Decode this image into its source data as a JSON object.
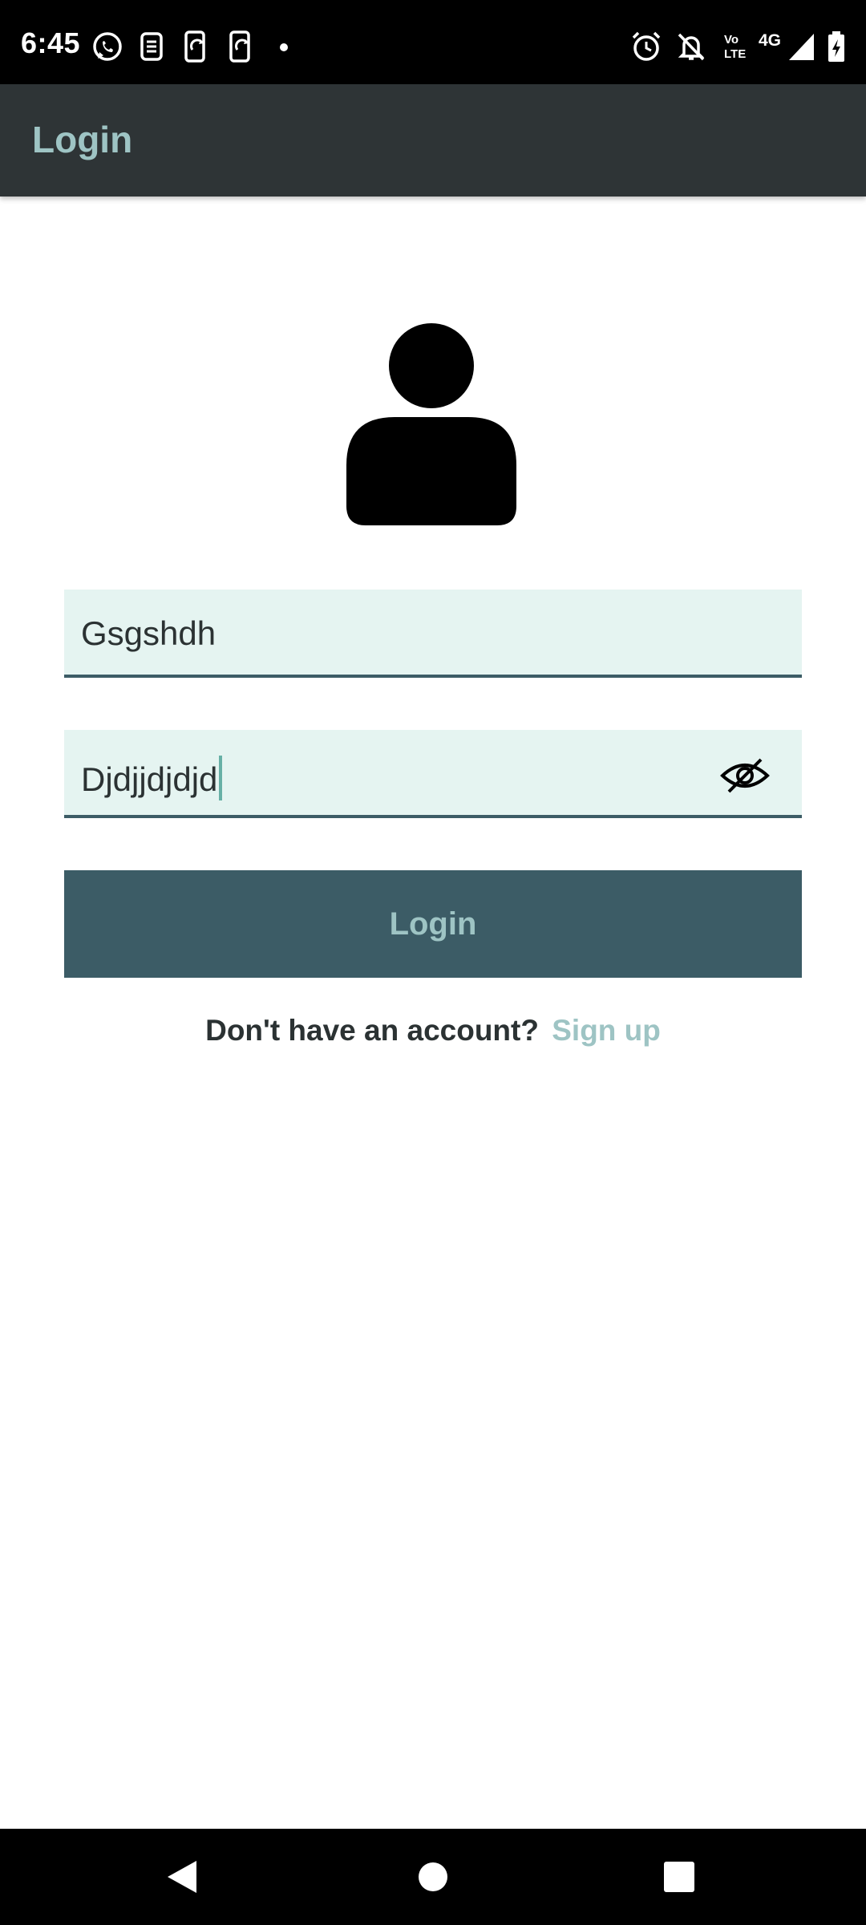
{
  "status_bar": {
    "time": "6:45",
    "left_icons": [
      "whatsapp-icon",
      "app-icon",
      "screen-sync-icon",
      "screen-sync-icon",
      "dot-icon"
    ],
    "right_icons": [
      "alarm-icon",
      "notifications-off-icon",
      "volte-icon",
      "network-4g-icon",
      "signal-icon",
      "battery-icon"
    ],
    "volte_line1": "Vo",
    "volte_line2": "LTE",
    "network_label": "4G"
  },
  "app_bar": {
    "title": "Login"
  },
  "form": {
    "username_value": "Gsgshdh",
    "password_value": "Djdjjdjdjd",
    "password_toggle_icon": "eye-off-icon",
    "login_label": "Login"
  },
  "signup": {
    "prompt": "Don't have an account?",
    "link_label": "Sign up"
  },
  "nav_bar": {
    "buttons": [
      "back-icon",
      "home-icon",
      "recents-icon"
    ]
  },
  "colors": {
    "app_bar": "#2e3436",
    "accent_text": "#9ec4c4",
    "field_background": "#e5f4f1",
    "button": "#3c5c66"
  }
}
